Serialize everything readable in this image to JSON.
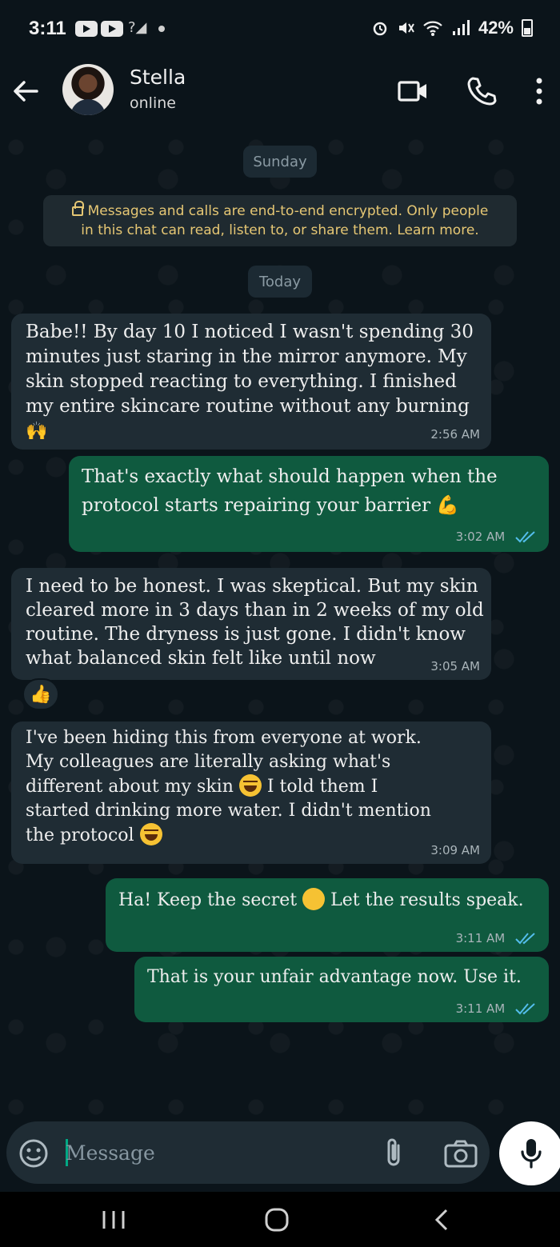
{
  "status_bar": {
    "time": "3:11",
    "battery": "42%"
  },
  "header": {
    "contact_name": "Stella",
    "contact_status": "online"
  },
  "chat": {
    "day_chips": [
      "Sunday",
      "Today"
    ],
    "encryption_notice_line1": "Messages and calls are end-to-end encrypted. Only people",
    "encryption_notice_line2": "in this chat can read, listen to, or share them. Learn more.",
    "messages": [
      {
        "direction": "incoming",
        "lines": [
          "Babe!! By day 10 I noticed I wasn't spending 30",
          "minutes just staring in the mirror anymore. My",
          "skin stopped reacting to everything. I finished",
          "my entire skincare routine without any burning"
        ],
        "emoji": "🙌",
        "time": "2:56 AM"
      },
      {
        "direction": "outgoing",
        "lines": [
          "That's exactly what should happen when the",
          "protocol starts repairing your barrier"
        ],
        "emoji": "💪",
        "time": "3:02 AM",
        "read": true
      },
      {
        "direction": "incoming",
        "lines": [
          "I need to be honest. I was skeptical. But my skin",
          "cleared more in 3 days than in 2 weeks of my old",
          "routine. The dryness is just gone. I didn't know",
          "what balanced skin felt like until now"
        ],
        "time": "3:05 AM",
        "reaction": "👍"
      },
      {
        "direction": "incoming",
        "lines": [
          "I've been hiding this from everyone at work.",
          "My colleagues are literally asking what's",
          "different about my skin",
          "I told them I",
          "started drinking more water. I didn't mention",
          "the protocol"
        ],
        "time": "3:09 AM"
      },
      {
        "direction": "outgoing",
        "text_before": "Ha! Keep the secret",
        "text_after": "Let the results speak.",
        "time": "3:11 AM",
        "read": true
      },
      {
        "direction": "outgoing",
        "text": "That is your unfair advantage now. Use it.",
        "time": "3:11 AM",
        "read": true
      }
    ]
  },
  "composer": {
    "placeholder": "Message"
  },
  "colors": {
    "background": "#0b141a",
    "incoming_bubble": "#1f2c34",
    "outgoing_bubble": "#0f5a3f",
    "read_ticks": "#53bdeb",
    "encryption_text": "#e6c774"
  }
}
